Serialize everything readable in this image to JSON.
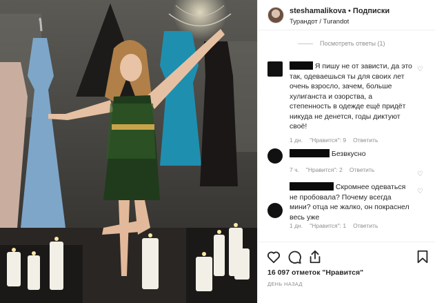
{
  "post": {
    "username": "steshamalikova",
    "separator": " • ",
    "follow_label": "Подписки",
    "location": "Турандот / Turandot"
  },
  "view_replies": "Посмотреть ответы (1)",
  "comments": [
    {
      "text": "Я пишу не от зависти, да это так, одеваешься ты для своих лет очень взросло, зачем, больше хулиганста и озорства, а степенность в одежде ещё придёт никуда не денется, годы диктуют своё!",
      "time": "1 дн.",
      "likes": "\"Нравится\": 9",
      "reply": "Ответить"
    },
    {
      "text": "Безвкусно",
      "time": "7 ч.",
      "likes": "\"Нравится\": 2",
      "reply": "Ответить"
    },
    {
      "text": "Скромнее одеваться не пробовала? Почему всегда мини? отца не жалко, он покраснел весь уже",
      "time": "1 дн.",
      "likes": "\"Нравится\": 1",
      "reply": "Ответить"
    }
  ],
  "likes_text": "16 097 отметок \"Нравится\"",
  "date_text": "ДЕНЬ НАЗАД",
  "icons": {
    "like": "heart-outline-icon",
    "comment": "speech-bubble-icon",
    "share": "share-upload-icon",
    "save": "bookmark-icon"
  }
}
